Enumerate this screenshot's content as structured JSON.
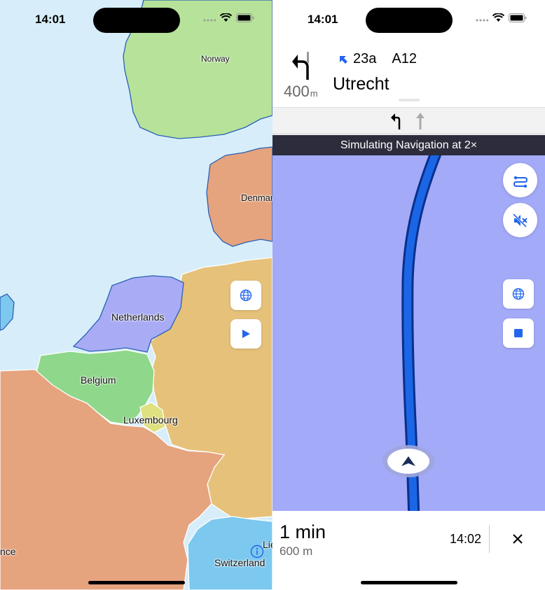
{
  "left": {
    "status": {
      "time": "14:01"
    },
    "labels": {
      "norway": "Norway",
      "denmark": "Denmar",
      "netherlands": "Netherlands",
      "belgium": "Belgium",
      "luxembourg": "Luxembourg",
      "france": "nce",
      "switzerland": "Switzerland",
      "liechtenstein": "Lie"
    },
    "buttons": {
      "globe_icon": "globe-icon",
      "play_icon": "play-icon",
      "info_icon": "info-icon"
    }
  },
  "right": {
    "status": {
      "time": "14:01"
    },
    "instruction": {
      "distance_value": "400",
      "distance_unit": "m",
      "exit": "23a",
      "road": "A12",
      "street": "Utrecht"
    },
    "banner": "Simulating Navigation at 2×",
    "footer": {
      "duration": "1 min",
      "distance": "600 m",
      "arrival": "14:02"
    }
  },
  "colors": {
    "sea": "#d7eefa",
    "norway": "#b6e29a",
    "denmark": "#e5a37e",
    "germany": "#e6c17a",
    "netherlands": "#a9acf5",
    "belgium": "#8fd78a",
    "luxembourg": "#dfe07f",
    "france": "#e5a37e",
    "switzerland": "#7cc8ef",
    "route": "#1a66e6",
    "nav_map": "#a3aaf8",
    "banner": "#2c2c3c",
    "accent": "#2266ee"
  }
}
